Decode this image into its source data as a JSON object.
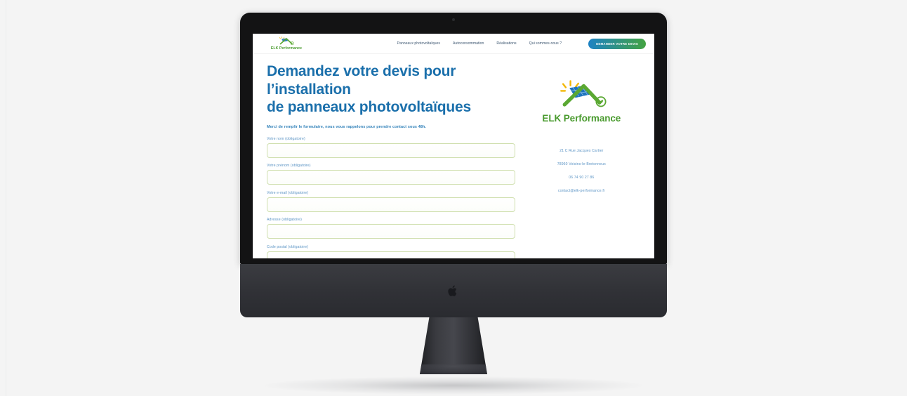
{
  "device": {
    "type": "imac-desktop-mockup",
    "brand_logo": "apple-logo"
  },
  "site": {
    "navbar": {
      "logo": {
        "icon": "solar-panel-logo-icon",
        "name": "ELK Performance"
      },
      "links": [
        {
          "label": "Panneaux photovoltaïques"
        },
        {
          "label": "Autoconsommation"
        },
        {
          "label": "Réalisations"
        },
        {
          "label": "Qui sommes-nous ?"
        }
      ],
      "cta_label": "DEMANDER VOTRE DEVIS"
    },
    "main": {
      "headline_line1": "Demandez votre devis pour l’installation",
      "headline_line2": "de panneaux photovoltaïques",
      "intro": "Merci de remplir le formulaire, nous vous rappelons pour prendre contact sous 48h.",
      "form": {
        "fields": [
          {
            "label": "Votre nom (obligatoire)",
            "value": "",
            "name": "nom"
          },
          {
            "label": "Votre prénom (obligatoire)",
            "value": "",
            "name": "prenom"
          },
          {
            "label": "Votre e-mail (obligatoire)",
            "value": "",
            "name": "email"
          },
          {
            "label": "Adresse (obligatoire)",
            "value": "",
            "name": "adresse"
          },
          {
            "label": "Code postal (obligatoire)",
            "value": "",
            "name": "code-postal"
          }
        ]
      }
    },
    "aside": {
      "logo": {
        "icon": "solar-panel-logo-icon",
        "name": "ELK Performance"
      },
      "contact": [
        {
          "text": "21 C Rue Jacques Cartier"
        },
        {
          "text": "78960 Voisins-le-Bretonneux"
        },
        {
          "text": "06 74 90 27 86"
        },
        {
          "text": "contact@elk-performance.fr"
        }
      ]
    }
  },
  "colors": {
    "heading_blue": "#1a6fab",
    "brand_green": "#4a9b2f",
    "label_blue": "#5a93c4",
    "input_border_green": "#cfdfae",
    "cta_gradient_start": "#1d82c4",
    "cta_gradient_end": "#43a341",
    "page_background": "#f4f4f4"
  }
}
